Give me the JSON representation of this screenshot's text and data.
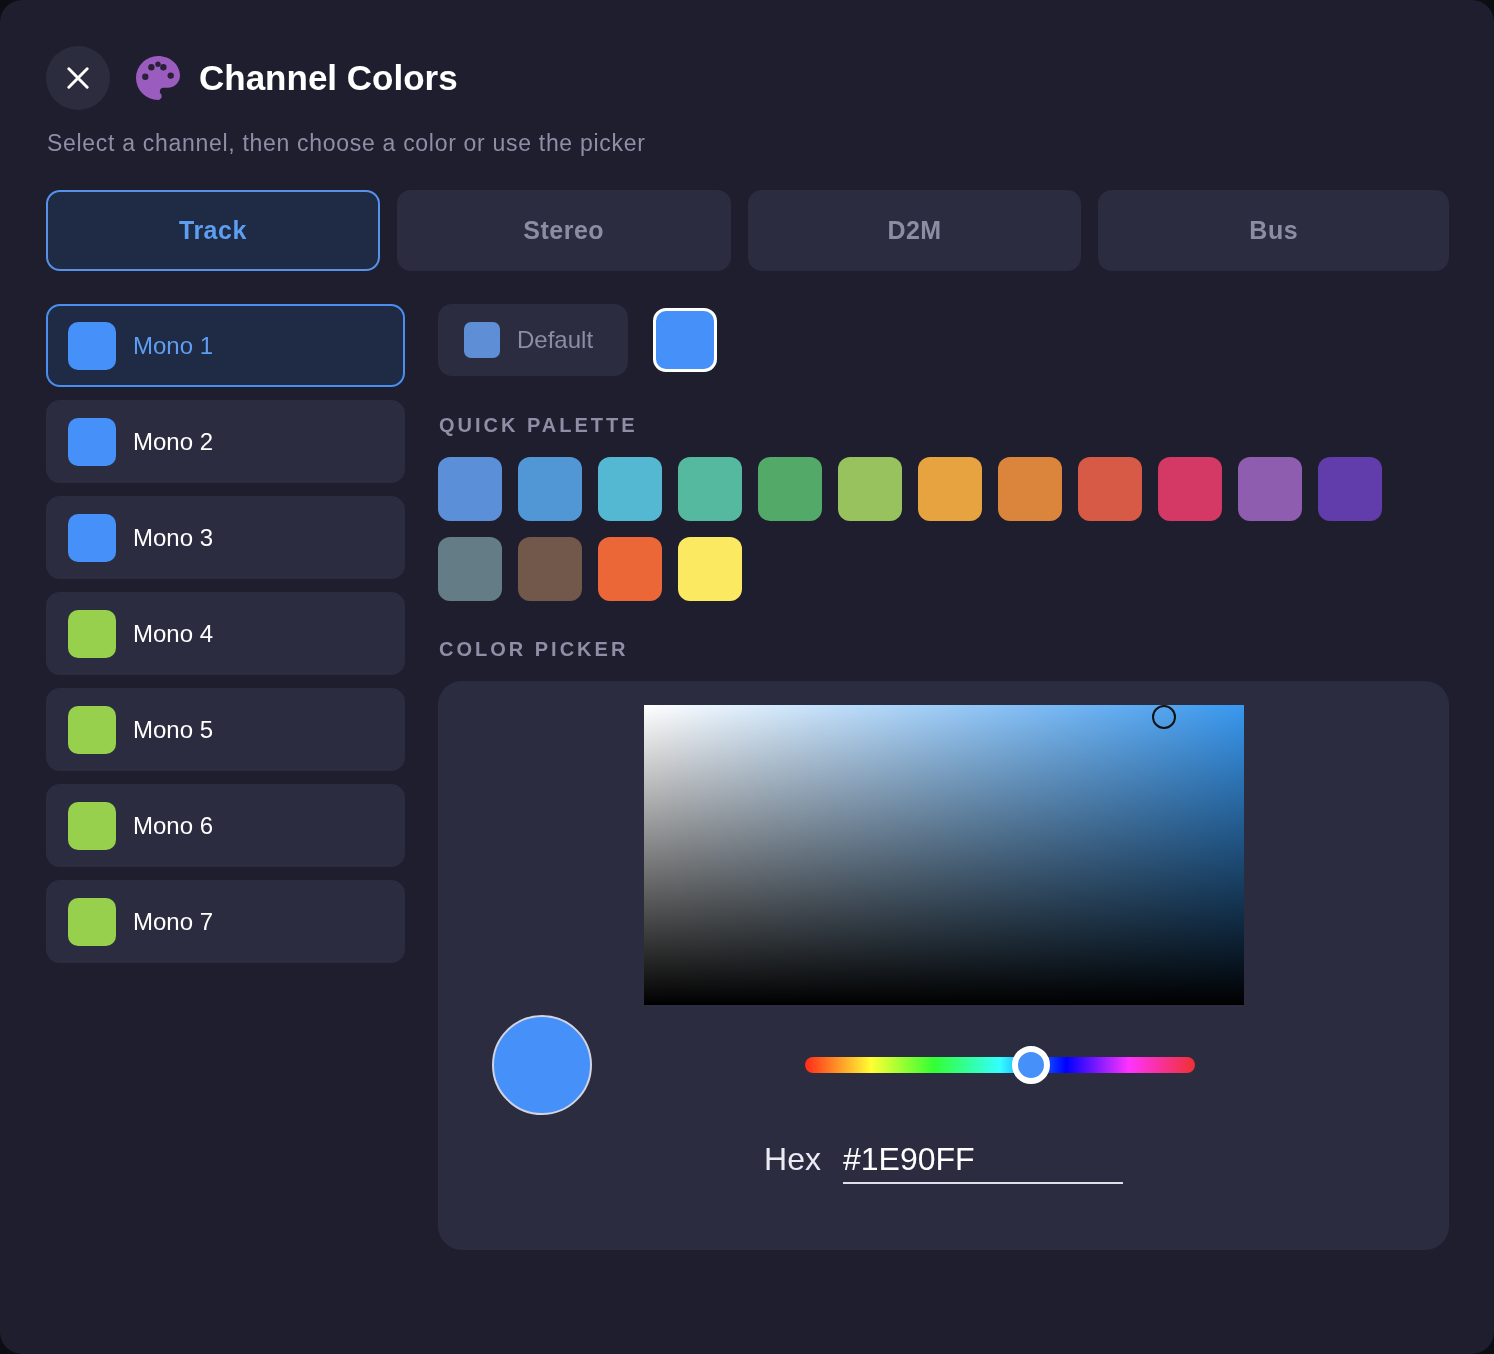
{
  "header": {
    "title": "Channel Colors",
    "subtitle": "Select a channel, then choose a color or use the picker"
  },
  "tabs": [
    {
      "label": "Track",
      "selected": true
    },
    {
      "label": "Stereo",
      "selected": false
    },
    {
      "label": "D2M",
      "selected": false
    },
    {
      "label": "Bus",
      "selected": false
    }
  ],
  "channels": [
    {
      "name": "Mono 1",
      "color": "#4690fa",
      "selected": true
    },
    {
      "name": "Mono 2",
      "color": "#4690fa",
      "selected": false
    },
    {
      "name": "Mono 3",
      "color": "#4690fa",
      "selected": false
    },
    {
      "name": "Mono 4",
      "color": "#96d04d",
      "selected": false
    },
    {
      "name": "Mono 5",
      "color": "#96d04d",
      "selected": false
    },
    {
      "name": "Mono 6",
      "color": "#96d04d",
      "selected": false
    },
    {
      "name": "Mono 7",
      "color": "#96d04d",
      "selected": false
    }
  ],
  "color_row": {
    "default_button": {
      "label": "Default",
      "color": "#5e8fd6"
    },
    "current_color": {
      "color": "#4690fa"
    }
  },
  "quick_palette": {
    "heading": "QUICK PALETTE",
    "swatches": [
      {
        "color": "#5b8fd8"
      },
      {
        "color": "#5197d6"
      },
      {
        "color": "#55b8d3"
      },
      {
        "color": "#55b9a0"
      },
      {
        "color": "#53aa68"
      },
      {
        "color": "#98c25e"
      },
      {
        "color": "#e6a33f"
      },
      {
        "color": "#db843c"
      },
      {
        "color": "#d65a45"
      },
      {
        "color": "#d43864"
      },
      {
        "color": "#8f5db0"
      },
      {
        "color": "#613cab"
      },
      {
        "color": "#647c86"
      },
      {
        "color": "#72584a"
      },
      {
        "color": "#ec6738"
      },
      {
        "color": "#fbe961"
      }
    ]
  },
  "color_picker": {
    "heading": "COLOR PICKER",
    "preview": {
      "color": "#4690fa"
    },
    "hue_slider": {
      "level": 0.58
    },
    "hex": {
      "label": "Hex",
      "value": "#1E90FF"
    }
  }
}
